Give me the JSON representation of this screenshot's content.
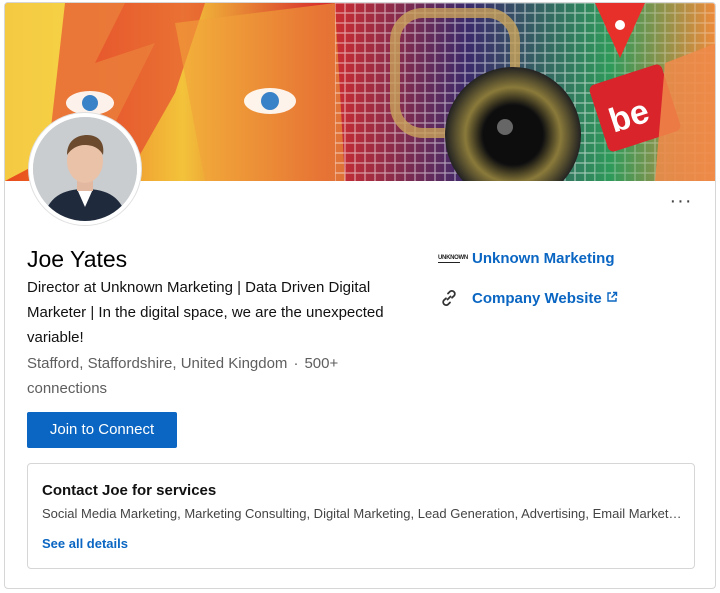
{
  "profile": {
    "name": "Joe Yates",
    "headline": "Director at Unknown Marketing | Data Driven Digital Marketer | In the digital space, we are the unexpected variable!",
    "location": "Stafford, Staffordshire, United Kingdom",
    "separator": "·",
    "connections": "500+ connections",
    "more_label": "···"
  },
  "actions": {
    "join_label": "Join to Connect"
  },
  "side_links": {
    "company": {
      "label": "Unknown Marketing",
      "logo_text": "UNKNOWN",
      "icon": "company-logo-icon"
    },
    "website": {
      "label": "Company Website",
      "icon": "link-icon",
      "external_icon": "external-link-icon"
    }
  },
  "services": {
    "title": "Contact Joe for services",
    "list": "Social Media Marketing, Marketing Consulting, Digital Marketing, Lead Generation, Advertising, Email Marketing",
    "see_all": "See all details"
  },
  "colors": {
    "accent": "#0a66c2",
    "button_bg": "#0a66c2",
    "secondary_text": "#5e5e5e",
    "border": "#d6d6d6"
  }
}
